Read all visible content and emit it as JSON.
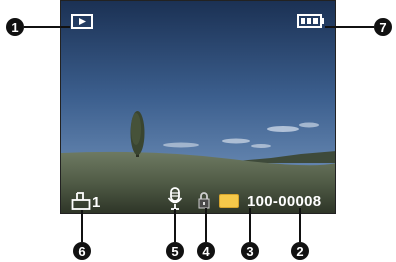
{
  "screen": {
    "mode_icon": "playback-icon",
    "battery_icon": "battery-full-icon",
    "print_icon": "print-dpof-icon",
    "print_count": "1",
    "voice_memo_icon": "voice-memo-icon",
    "protect_icon": "protect-lock-icon",
    "memory_card_icon": "sd-card-icon",
    "file_number": "100-00008"
  },
  "callouts": {
    "c1": "1",
    "c2": "2",
    "c3": "3",
    "c4": "4",
    "c5": "5",
    "c6": "6",
    "c7": "7"
  },
  "colors": {
    "overlay": "#ffffff",
    "card": "#f6c94a",
    "callout": "#111111"
  }
}
